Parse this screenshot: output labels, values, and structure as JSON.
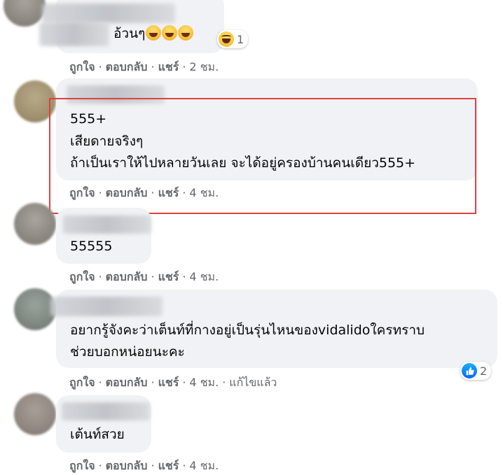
{
  "comments": [
    {
      "lines": [
        "อ้วนๆ"
      ],
      "emoji": [
        "rolling-laughing-emoji",
        "rolling-laughing-emoji",
        "rolling-laughing-emoji"
      ],
      "reaction": {
        "icon": "haha-icon",
        "count": "1"
      },
      "like": "ถูกใจ",
      "reply": "ตอบกลับ",
      "share": "แชร์",
      "time": "2 ชม."
    },
    {
      "lines": [
        "555+",
        "เสียดายจริงๆ",
        "ถ้าเป็นเราให้ไปหลายวันเลย จะได้อยู่ครองบ้านคนเดียว555+"
      ],
      "like": "ถูกใจ",
      "reply": "ตอบกลับ",
      "share": "แชร์",
      "time": "4 ชม."
    },
    {
      "lines": [
        "55555"
      ],
      "like": "ถูกใจ",
      "reply": "ตอบกลับ",
      "share": "แชร์",
      "time": "4 ชม."
    },
    {
      "lines": [
        "อยากรู้จังคะว่าเต็นท์ที่กางอยู่เป็นรุ่นไหนของvidalidoใครทราบ",
        "ช่วยบอกหน่อยนะคะ"
      ],
      "reaction": {
        "icon": "like-icon",
        "count": "2"
      },
      "like": "ถูกใจ",
      "reply": "ตอบกลับ",
      "share": "แชร์",
      "time": "4 ชม.",
      "edited": "แก้ไขแล้ว"
    },
    {
      "lines": [
        "เต้นท์สวย"
      ],
      "like": "ถูกใจ",
      "reply": "ตอบกลับ",
      "share": "แชร์",
      "time": "4 ชม."
    }
  ],
  "separator": "·",
  "colors": {
    "bubble": "#f0f2f5",
    "meta": "#65676b",
    "highlight": "#e0403d",
    "like_blue": "#0866ff"
  }
}
